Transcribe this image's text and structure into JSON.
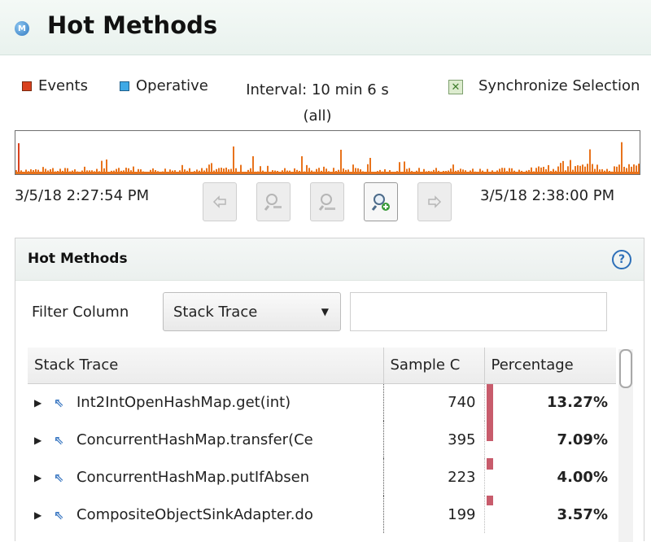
{
  "app": {
    "title": "Hot Methods",
    "icon": "M"
  },
  "legend": {
    "events": {
      "label": "Events",
      "color": "#d9411e"
    },
    "operative": {
      "label": "Operative",
      "color": "#3fa9e6"
    }
  },
  "interval": {
    "line1": "Interval: 10 min 6 s",
    "line2": "(all)"
  },
  "sync": {
    "label": "Synchronize Selection",
    "checked": true
  },
  "timeline": {
    "start": "3/5/18 2:27:54 PM",
    "end": "3/5/18 2:38:00 PM",
    "bar_color": "#e8731c",
    "marker_color": "#d9411e",
    "buttons": [
      {
        "name": "previous-button",
        "icon": "arrow-left-icon",
        "enabled": false
      },
      {
        "name": "zoom-out-button",
        "icon": "zoom-out-icon",
        "enabled": false
      },
      {
        "name": "zoom-out-all-button",
        "icon": "zoom-out-all-icon",
        "enabled": false
      },
      {
        "name": "zoom-in-button",
        "icon": "zoom-in-icon",
        "enabled": true
      },
      {
        "name": "next-button",
        "icon": "arrow-right-icon",
        "enabled": false
      }
    ]
  },
  "section": {
    "title": "Hot Methods",
    "help": "?"
  },
  "filter": {
    "label": "Filter Column",
    "selected": "Stack Trace",
    "value": ""
  },
  "table": {
    "columns": [
      "Stack Trace",
      "Sample C",
      "Percentage"
    ],
    "rows": [
      {
        "method": "Int2IntOpenHashMap.get(int)",
        "count": "740",
        "percentage": "13.27%",
        "fraction": 0.1327
      },
      {
        "method": "ConcurrentHashMap.transfer(Ce",
        "count": "395",
        "percentage": "7.09%",
        "fraction": 0.0709
      },
      {
        "method": "ConcurrentHashMap.putIfAbsen",
        "count": "223",
        "percentage": "4.00%",
        "fraction": 0.04
      },
      {
        "method": "CompositeObjectSinkAdapter.do",
        "count": "199",
        "percentage": "3.57%",
        "fraction": 0.0357
      }
    ],
    "bar_color": "#c85c6c"
  }
}
